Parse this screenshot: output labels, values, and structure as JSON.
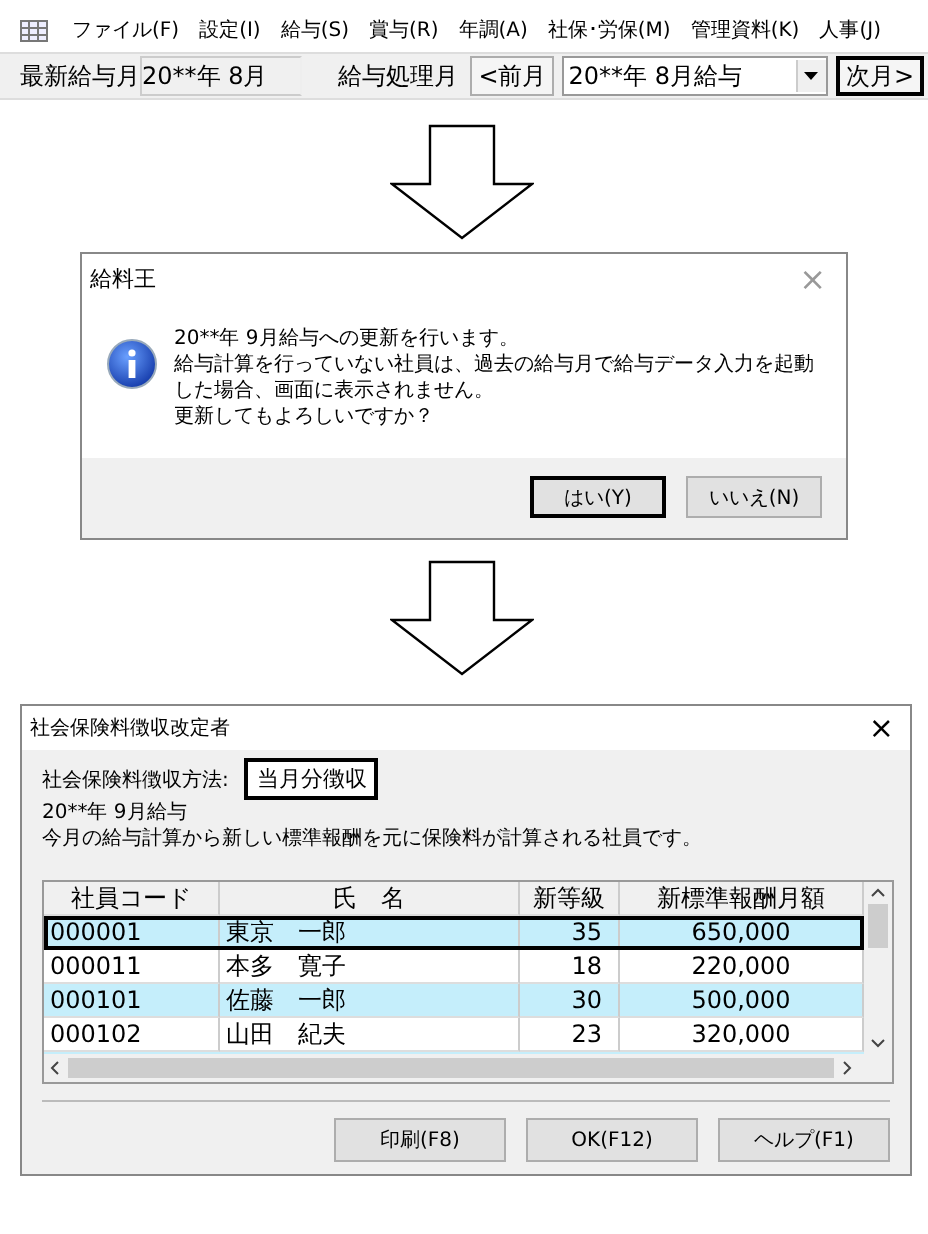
{
  "menu_bar": {
    "items": [
      "ファイル(F)",
      "設定(I)",
      "給与(S)",
      "賞与(R)",
      "年調(A)",
      "社保･労保(M)",
      "管理資料(K)",
      "人事(J)"
    ]
  },
  "toolbar": {
    "latest_label": "最新給与月",
    "latest_value": "20**年  8月",
    "processing_label": "給与処理月",
    "prev_button": "<前月",
    "month_select": "20**年  8月給与",
    "next_button": {
      "label": "次月>",
      "focused": true
    }
  },
  "confirm_dialog": {
    "title": "給料王",
    "close": "×",
    "message": [
      "20**年 9月給与への更新を行います。",
      "給与計算を行っていない社員は、過去の給与月で給与データ入力を起動",
      "した場合、画面に表示されません。",
      "更新してもよろしいですか？"
    ],
    "buttons": [
      {
        "label": "はい(Y)",
        "focused": true
      },
      {
        "label": "いいえ(N)",
        "focused": false
      }
    ]
  },
  "insurance_dialog": {
    "title": "社会保険料徴収改定者",
    "close": "×",
    "method_label": "社会保険料徴収方法:",
    "method_value": "当月分徴収",
    "month": "20**年 9月給与",
    "description": "今月の給与計算から新しい標準報酬を元に保険料が計算される社員です。",
    "table": {
      "columns": [
        "社員コード",
        "氏　名",
        "新等級",
        "新標準報酬月額"
      ],
      "rows": [
        {
          "cells": [
            "000001",
            "東京　一郎",
            "35",
            "650,000"
          ],
          "selected": true
        },
        {
          "cells": [
            "000011",
            "本多　寛子",
            "18",
            "220,000"
          ],
          "selected": false
        },
        {
          "cells": [
            "000101",
            "佐藤　一郎",
            "30",
            "500,000"
          ],
          "selected": false
        },
        {
          "cells": [
            "000102",
            "山田　紀夫",
            "23",
            "320,000"
          ],
          "selected": false
        }
      ]
    },
    "buttons": [
      {
        "label": "印刷(F8)",
        "focused": false
      },
      {
        "label": "OK(F12)",
        "focused": false
      },
      {
        "label": "ヘルプ(F1)",
        "focused": false
      }
    ]
  }
}
